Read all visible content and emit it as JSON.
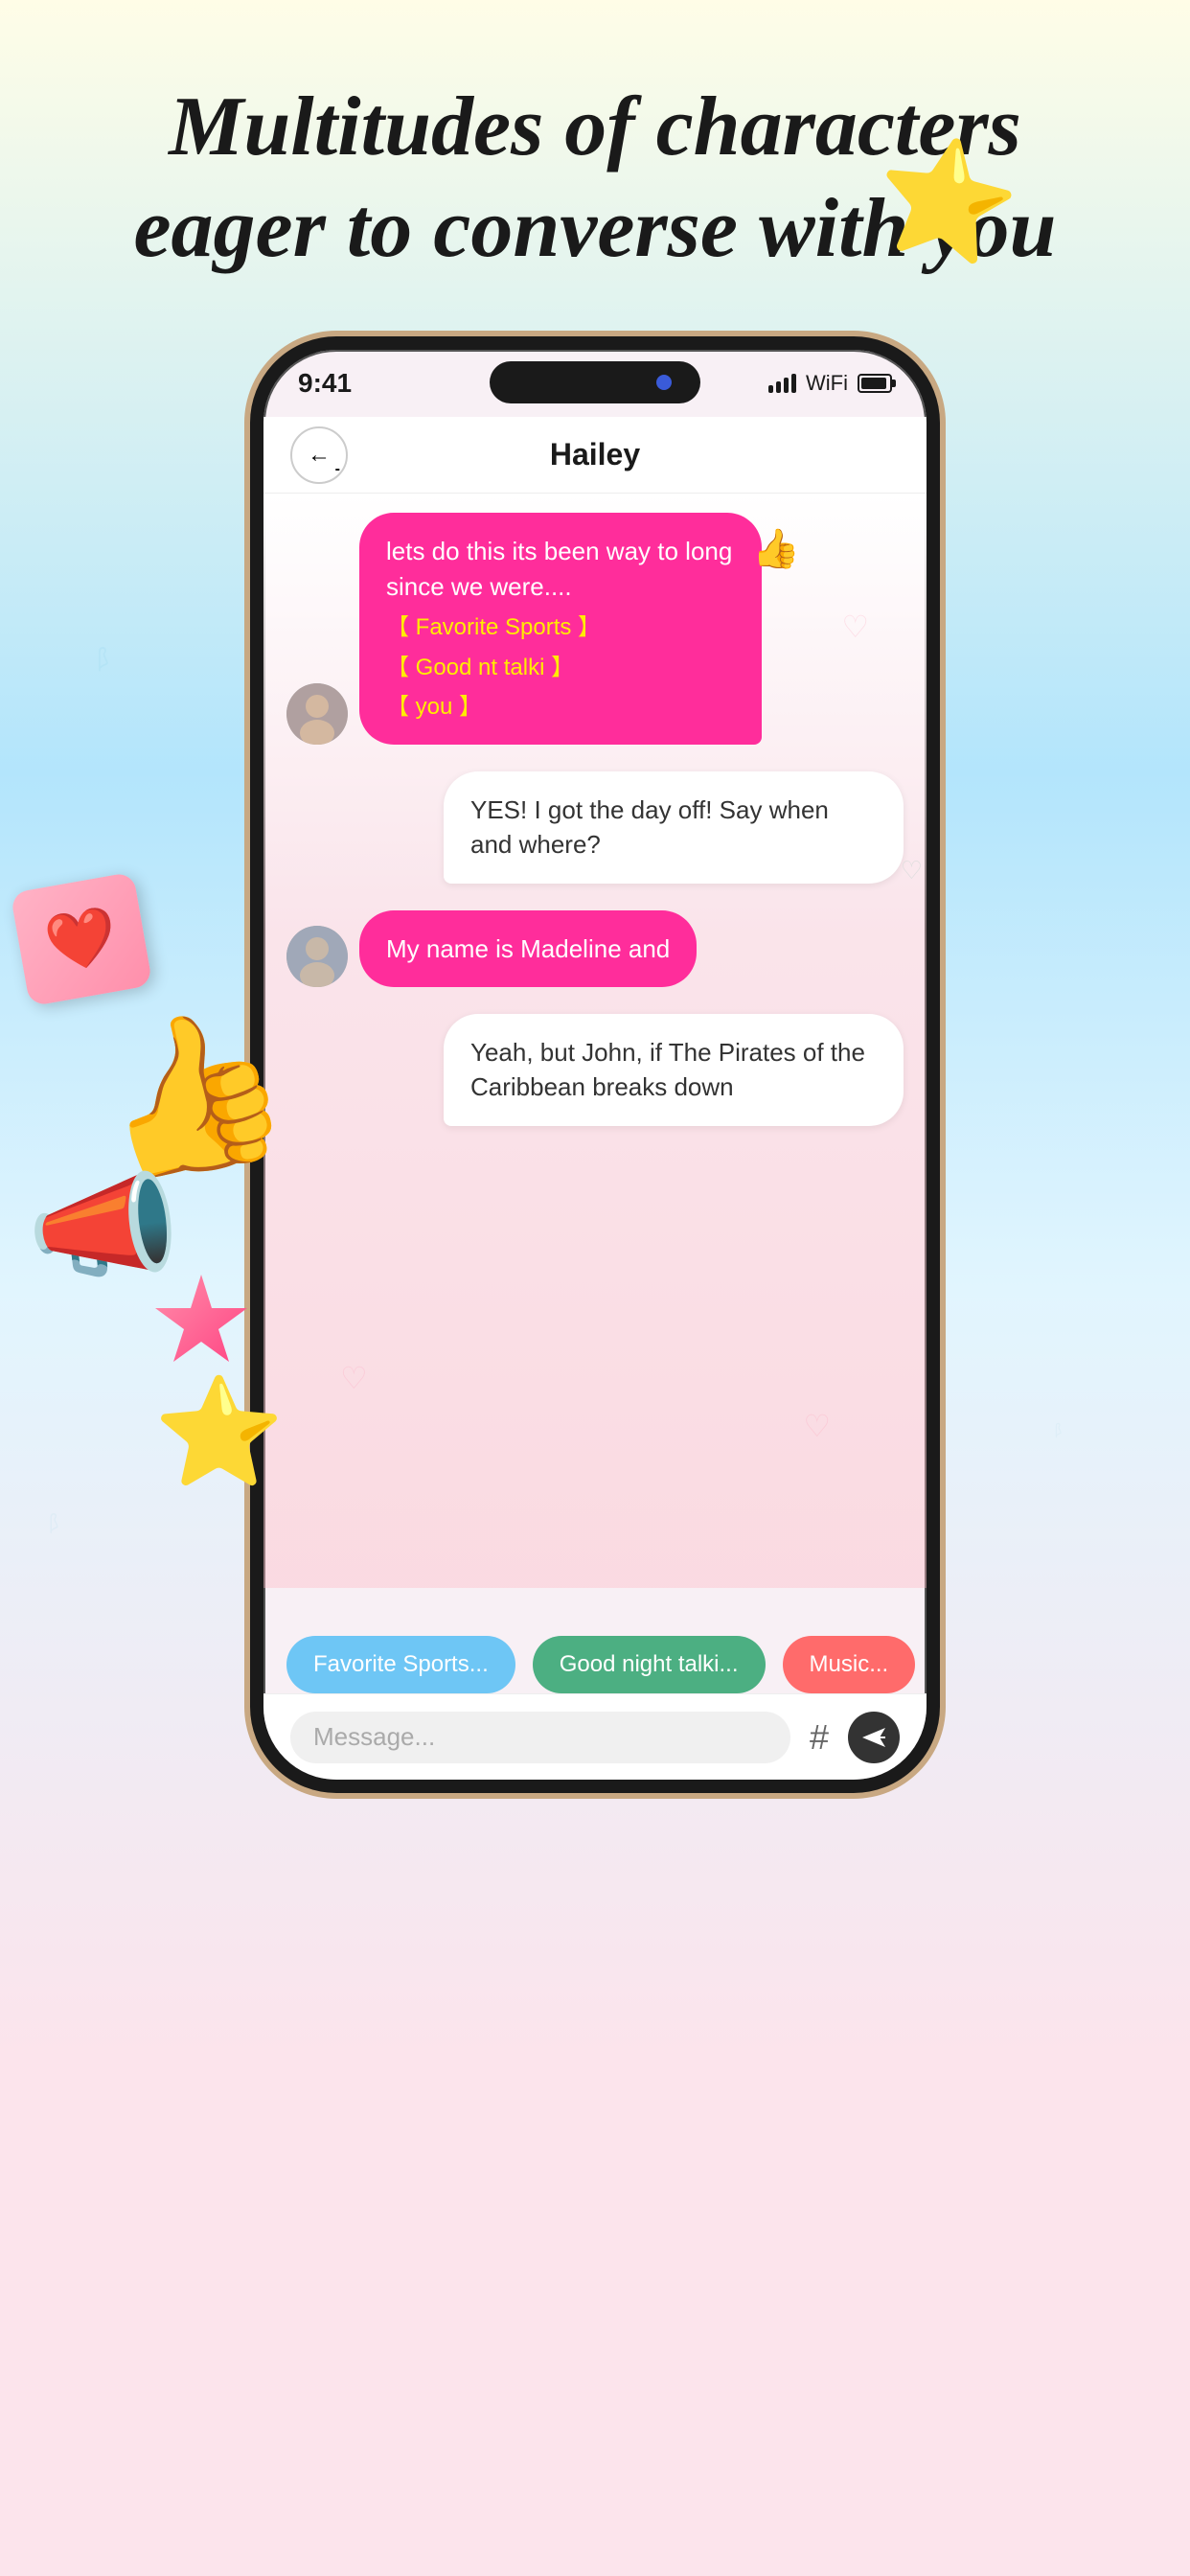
{
  "headline": {
    "line1": "Multitudes of characters",
    "line2": "eager to converse with you"
  },
  "status_bar": {
    "time": "9:41",
    "signal": "signal",
    "wifi": "wifi",
    "battery": "battery"
  },
  "chat_header": {
    "title": "Hailey",
    "back_label": "←"
  },
  "messages": [
    {
      "id": 1,
      "type": "received",
      "has_avatar": true,
      "text": "lets do this its been way to long since we were....",
      "extra_lines": [
        "【 Favorite Sports 】",
        "【 Good nt talki 】",
        "【        you 】"
      ],
      "style": "sent-pink",
      "thumbs_up": true
    },
    {
      "id": 2,
      "type": "sent",
      "has_avatar": false,
      "text": "YES! I got the day off! Say when and where?",
      "style": "received-white",
      "heart": true
    },
    {
      "id": 3,
      "type": "received",
      "has_avatar": true,
      "text": "My name is Madeline and",
      "style": "sent-pink-pill"
    },
    {
      "id": 4,
      "type": "sent",
      "has_avatar": false,
      "text": "Yeah, but John, if The Pirates of the Caribbean breaks down",
      "style": "received-white"
    }
  ],
  "quick_replies": [
    {
      "label": "Favorite Sports...",
      "style": "chip-blue"
    },
    {
      "label": "Good night talki...",
      "style": "chip-green"
    },
    {
      "label": "Music...",
      "style": "chip-coral"
    }
  ],
  "input_bar": {
    "placeholder": "Message...",
    "hashtag": "#",
    "send": "send"
  }
}
